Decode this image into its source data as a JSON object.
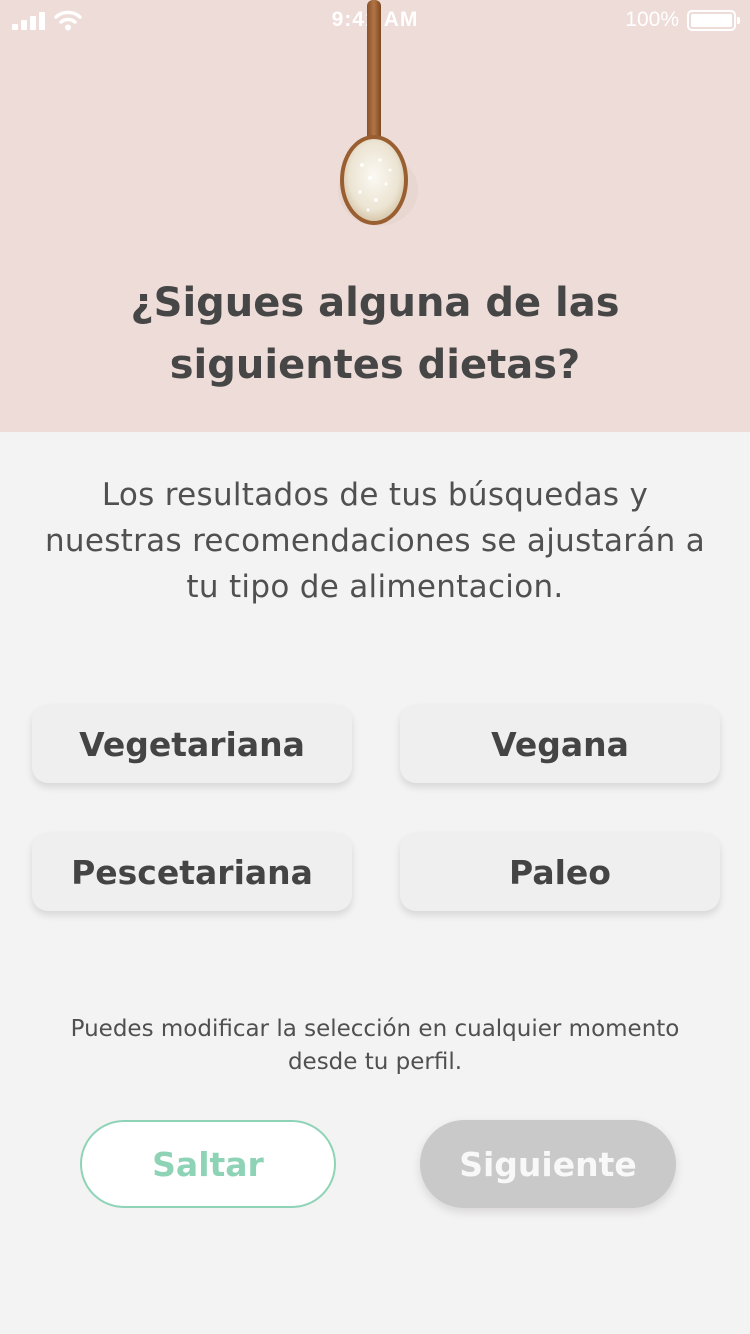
{
  "status_bar": {
    "time": "9:41 AM",
    "battery": "100%"
  },
  "hero": {
    "image": "spoon-with-rice",
    "title": "¿Sigues alguna de las siguientes dietas?"
  },
  "description": "Los resultados de tus búsquedas y nuestras recomendaciones se ajustarán a tu tipo de alimentacion.",
  "options": [
    {
      "label": "Vegetariana"
    },
    {
      "label": "Vegana"
    },
    {
      "label": "Pescetariana"
    },
    {
      "label": "Paleo"
    }
  ],
  "hint": "Puedes modificar la selección en cualquier momento desde tu perfil.",
  "buttons": {
    "skip": "Saltar",
    "next": "Siguiente"
  },
  "colors": {
    "hero_background": "#eddcd8",
    "accent": "#8fd3b7",
    "disabled": "#c9c9c9"
  }
}
